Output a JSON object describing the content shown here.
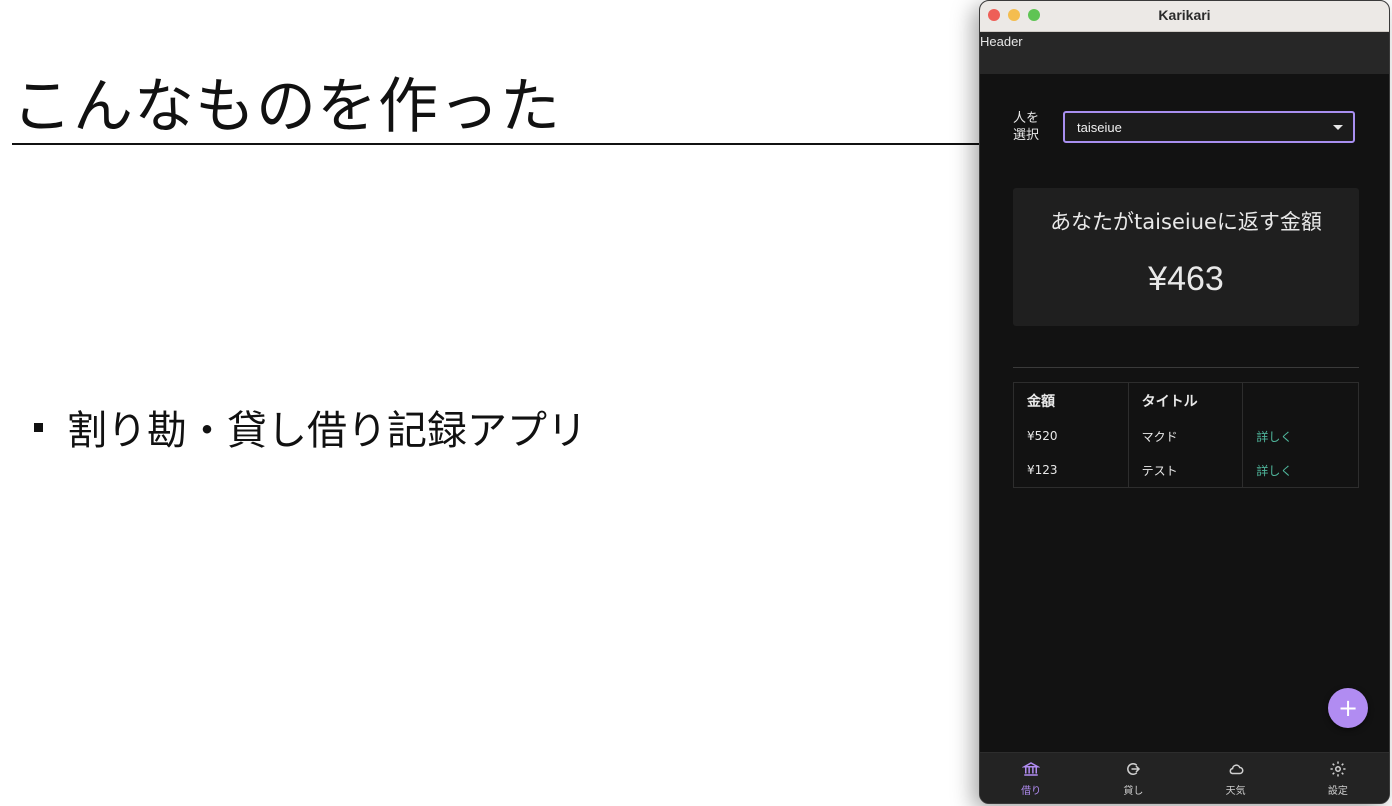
{
  "slide": {
    "title": "こんなものを作った",
    "bullet": "割り勘・貸し借り記録アプリ"
  },
  "window": {
    "title": "Karikari",
    "header": "Header"
  },
  "selector": {
    "label": "人を選択",
    "value": "taiseiue"
  },
  "summary": {
    "heading": "あなたがtaiseiueに返す金額",
    "amount": "¥463"
  },
  "table": {
    "headers": [
      "金額",
      "タイトル",
      ""
    ],
    "rows": [
      {
        "amount": "¥520",
        "title": "マクド",
        "action": "詳しく"
      },
      {
        "amount": "¥123",
        "title": "テスト",
        "action": "詳しく"
      }
    ]
  },
  "fab": {
    "label": "+",
    "icon": "plus-icon"
  },
  "nav": {
    "items": [
      {
        "label": "借り",
        "icon": "bank-icon",
        "active": true
      },
      {
        "label": "貸し",
        "icon": "arrow-circle-icon",
        "active": false
      },
      {
        "label": "天気",
        "icon": "cloud-icon",
        "active": false
      },
      {
        "label": "設定",
        "icon": "gear-icon",
        "active": false
      }
    ]
  },
  "colors": {
    "accent": "#b18cf2",
    "link": "#4fb59b",
    "background": "#121212"
  }
}
